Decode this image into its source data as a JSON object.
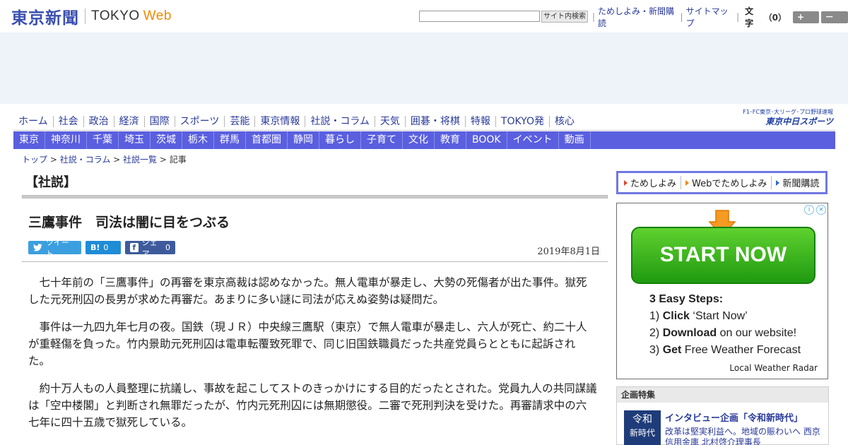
{
  "header": {
    "logo_jp": "東京新聞",
    "logo_en": "TOKYO",
    "logo_web": "Web",
    "search_button": "サイト内検索",
    "links": [
      "ためしよみ・新聞購読",
      "サイトマップ"
    ],
    "font_size_label": "文字",
    "font_size_value": "（0）",
    "font_plus": "+ 大",
    "font_minus": "－ 小"
  },
  "nav_primary": [
    "ホーム",
    "社会",
    "政治",
    "経済",
    "国際",
    "スポーツ",
    "芸能",
    "東京情報",
    "社説・コラム",
    "天気",
    "囲碁・将棋",
    "特報",
    "TOKYO発",
    "核心"
  ],
  "chunichi": {
    "tagline": "F1･FC東京･大リーグ･プロ野球速報",
    "name": "東京中日スポーツ"
  },
  "nav_regional": [
    "東京",
    "神奈川",
    "千葉",
    "埼玉",
    "茨城",
    "栃木",
    "群馬",
    "首都圏",
    "静岡",
    "暮らし",
    "子育て",
    "文化",
    "教育",
    "BOOK",
    "イベント",
    "動画"
  ],
  "breadcrumb": [
    "トップ",
    "社説・コラム",
    "社説一覧",
    "記事"
  ],
  "article": {
    "section": "【社説】",
    "title": "三鷹事件　司法は闇に目をつぶる",
    "date": "2019年8月1日",
    "share": {
      "tweet": "ツイート",
      "hatena_count": "0",
      "facebook": "シェア",
      "facebook_count": "0"
    },
    "paragraphs": [
      "七十年前の「三鷹事件」の再審を東京高裁は認めなかった。無人電車が暴走し、大勢の死傷者が出た事件。獄死した元死刑囚の長男が求めた再審だ。あまりに多い謎に司法が応えぬ姿勢は疑問だ。",
      "事件は一九四九年七月の夜。国鉄（現ＪＲ）中央線三鷹駅（東京）で無人電車が暴走し、六人が死亡、約二十人が重軽傷を負った。竹内景助元死刑囚は電車転覆致死罪で、同じ旧国鉄職員だった共産党員らとともに起訴された。",
      "約十万人もの人員整理に抗議し、事故を起こしてストのきっかけにする目的だったとされた。党員九人の共同謀議は「空中楼閣」と判断され無罪だったが、竹内元死刑囚には無期懲役。二審で死刑判決を受けた。再審請求中の六七年に四十五歳で獄死している。"
    ]
  },
  "subscribe": [
    "ためしよみ",
    "Webでためしよみ",
    "新聞購読"
  ],
  "ad": {
    "button": "START NOW",
    "steps_title": "3 Easy Steps:",
    "steps": [
      {
        "num": "1)",
        "bold": "Click",
        "rest": " ‘Start Now’"
      },
      {
        "num": "2)",
        "bold": "Download",
        "rest": " on our website!"
      },
      {
        "num": "3)",
        "bold": "Get",
        "rest": " Free Weather Forecast"
      }
    ],
    "brand": "Local Weather Radar"
  },
  "feature": {
    "heading": "企画特集",
    "thumb_line1": "令和",
    "thumb_line2": "新時代",
    "title": "インタビュー企画「令和新時代」",
    "text": "改革は堅実利益へ。地域の賑わいへ 西京信用金庫 北村啓介理事長"
  }
}
